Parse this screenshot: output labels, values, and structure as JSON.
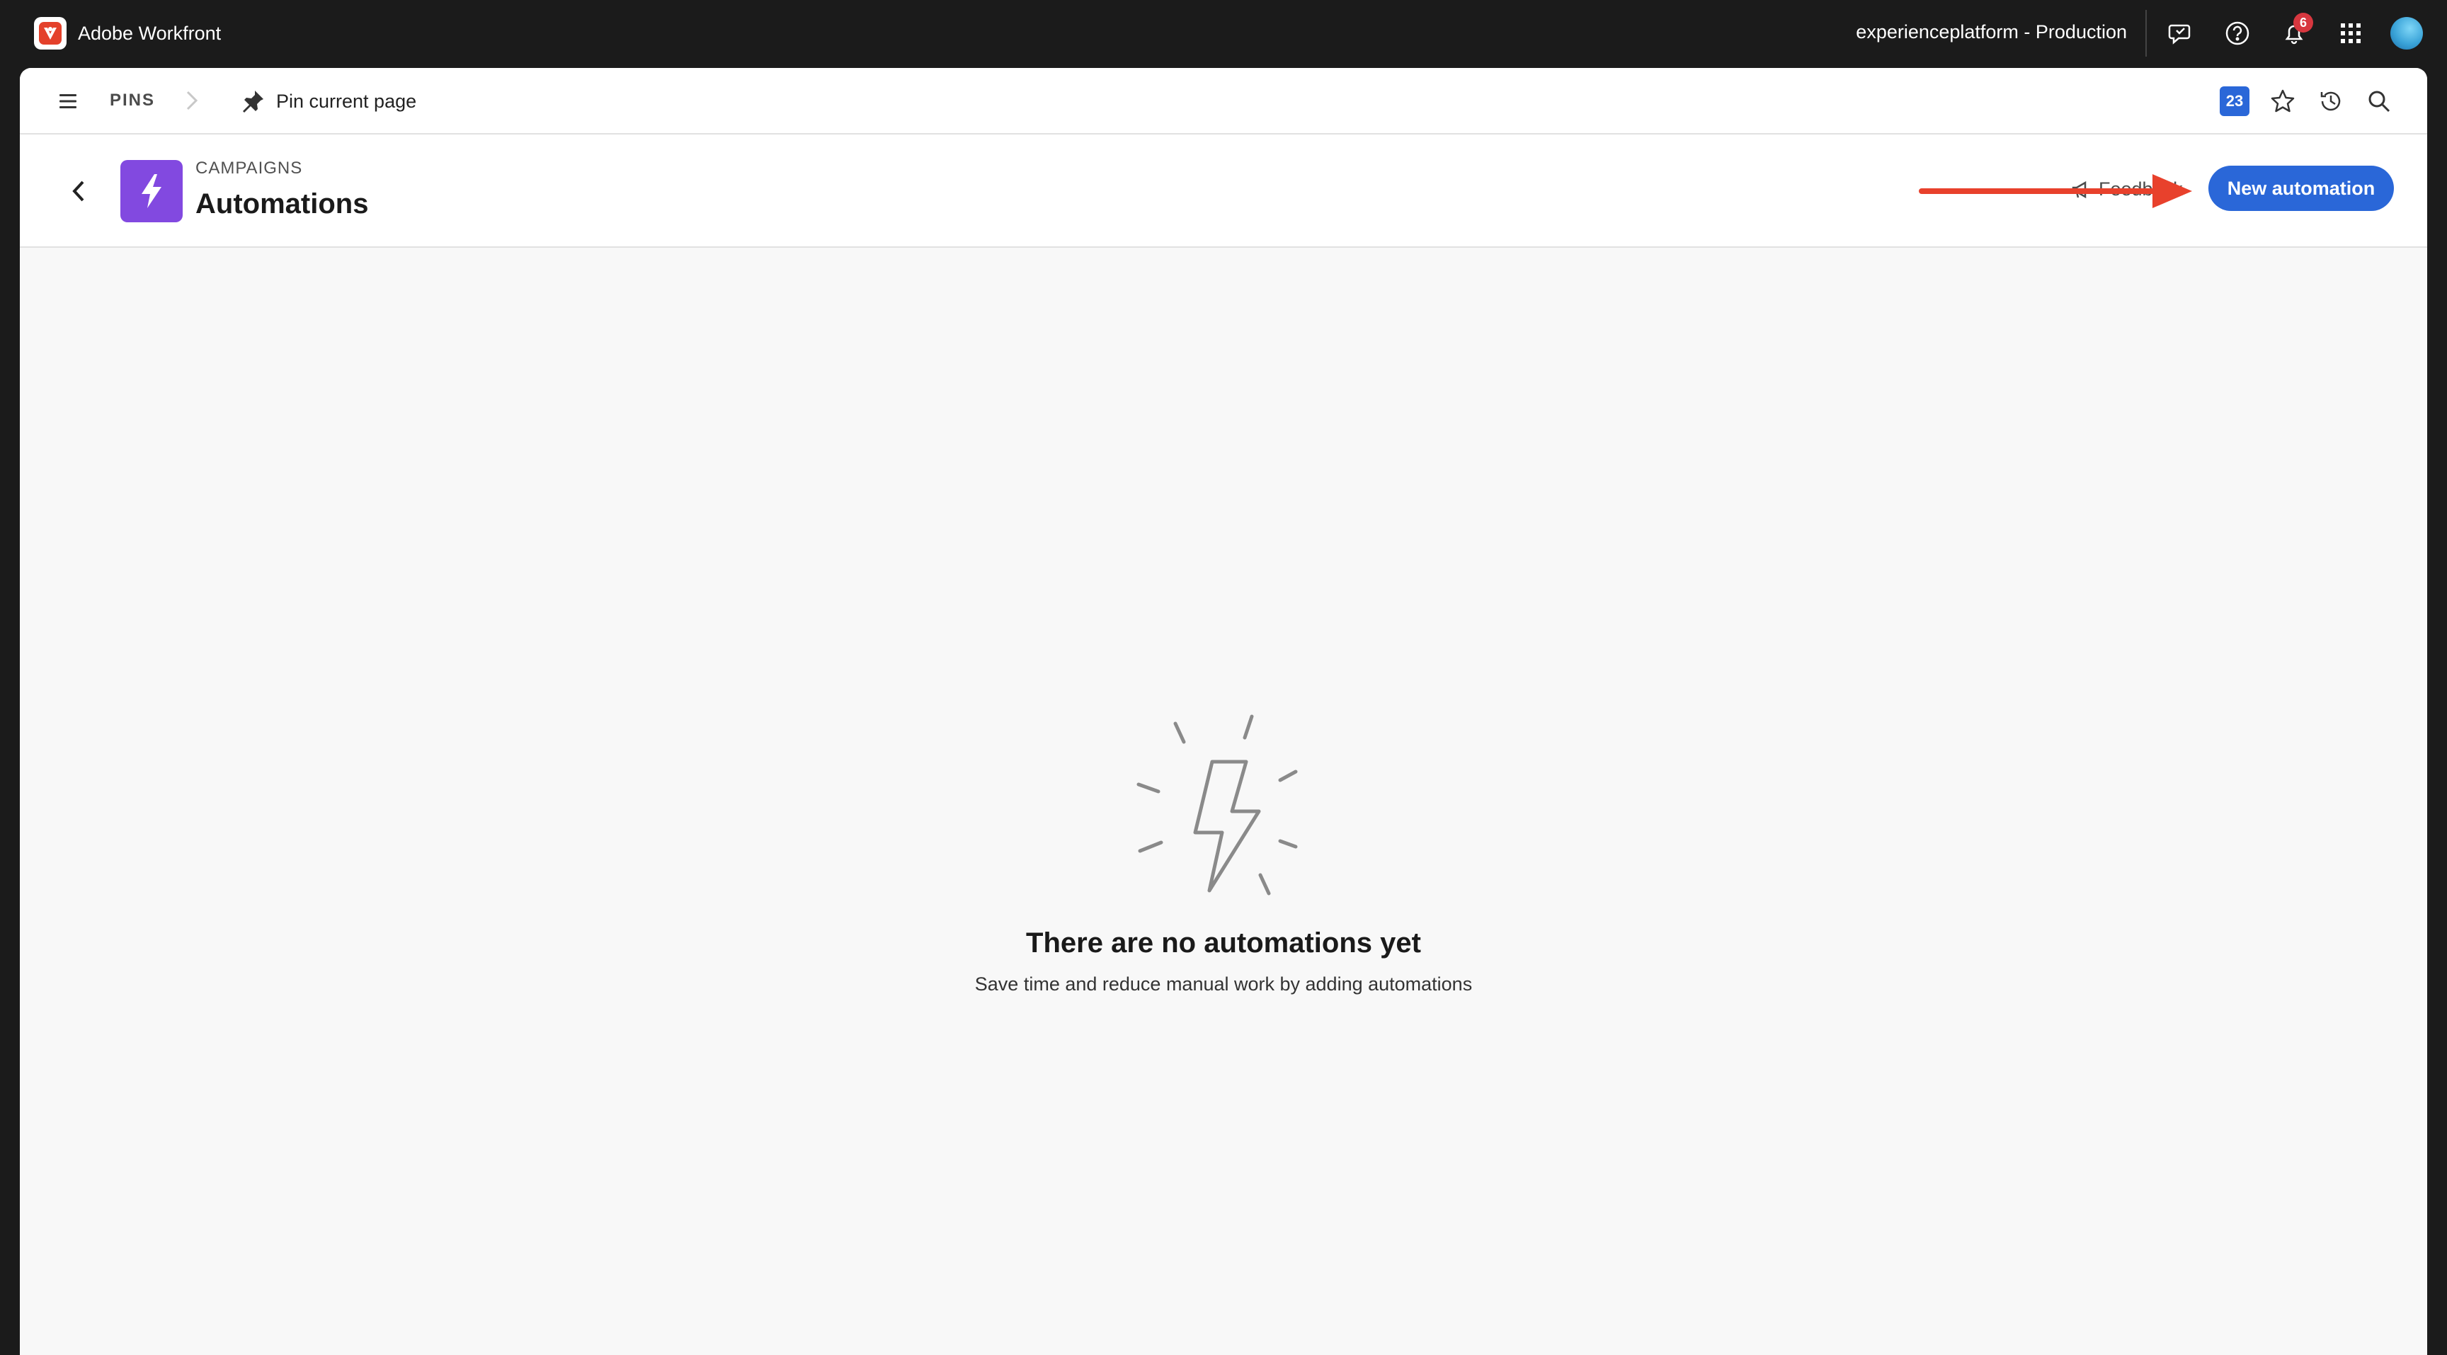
{
  "topbar": {
    "app_name": "Adobe Workfront",
    "org_name": "experienceplatform - Production",
    "notification_count": "6",
    "icons": [
      "feedback-chat-icon",
      "help-icon",
      "bell-icon",
      "apps-grid-icon",
      "avatar"
    ]
  },
  "pinsbar": {
    "pins_label": "PINS",
    "pin_current_label": "Pin current page",
    "calendar_day": "23",
    "icons": [
      "menu-icon",
      "chevron-right-icon",
      "pin-icon",
      "calendar-icon",
      "star-icon",
      "history-icon",
      "search-icon"
    ]
  },
  "header": {
    "breadcrumb": "CAMPAIGNS",
    "title": "Automations",
    "feedback_label": "Feedback",
    "new_button_label": "New automation"
  },
  "empty_state": {
    "title": "There are no automations yet",
    "subtitle": "Save time and reduce manual work by adding automations"
  },
  "colors": {
    "topbar_bg": "#1b1b1b",
    "accent_blue": "#2a67d8",
    "app_tile_purple": "#8249e0",
    "annotation_red": "#e8412c",
    "badge_red": "#d7373f"
  }
}
